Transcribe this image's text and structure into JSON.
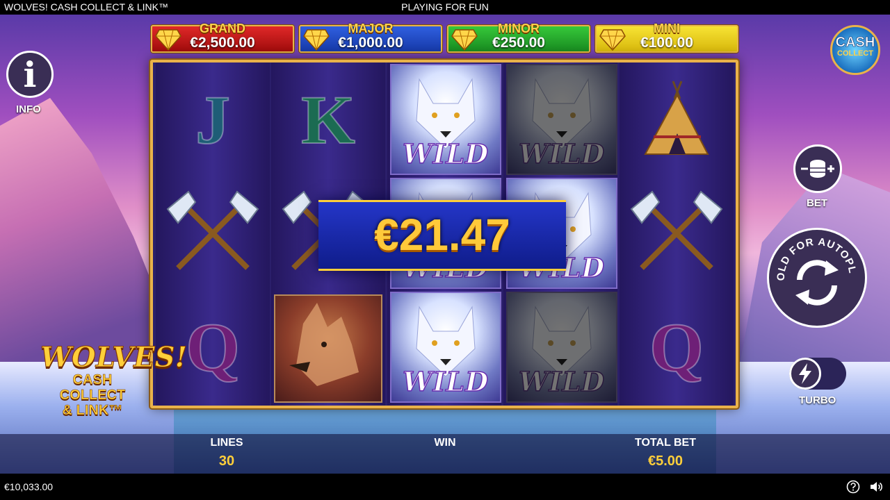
{
  "topbar": {
    "game_title": "WOLVES! CASH COLLECT & LINK™",
    "mode": "PLAYING FOR FUN"
  },
  "jackpots": [
    {
      "name": "GRAND",
      "value": "€2,500.00",
      "color": "#c81818"
    },
    {
      "name": "MAJOR",
      "value": "€1,000.00",
      "color": "#2448c8"
    },
    {
      "name": "MINOR",
      "value": "€250.00",
      "color": "#26a82c"
    },
    {
      "name": "MINI",
      "value": "€100.00",
      "color": "#eccc20"
    }
  ],
  "reels": [
    [
      "J",
      "tomahawks",
      "Q"
    ],
    [
      "K",
      "tomahawks",
      "brown-wolf"
    ],
    [
      "wild",
      "wild",
      "wild"
    ],
    [
      "wild",
      "wild",
      "wild"
    ],
    [
      "teepee",
      "tomahawks",
      "Q"
    ]
  ],
  "wild_label": "WILD",
  "win_banner": {
    "amount": "€21.47"
  },
  "left": {
    "info_label": "INFO",
    "logo_line1": "WOLVES!",
    "logo_line2": "CASH COLLECT",
    "logo_line3": "& LINK™"
  },
  "right": {
    "cash_logo_line1": "CASH",
    "cash_logo_line2": "COLLECT",
    "bet_label": "BET",
    "autoplay_text": "HOLD FOR AUTOPLAY",
    "turbo_label": "TURBO",
    "turbo_on": false
  },
  "stats": {
    "lines_label": "LINES",
    "lines_value": "30",
    "win_label": "WIN",
    "win_value": "",
    "total_bet_label": "TOTAL BET",
    "total_bet_value": "€5.00"
  },
  "bottombar": {
    "balance": "€10,033.00",
    "help_icon": "question-circle-icon",
    "sound_icon": "speaker-icon"
  }
}
